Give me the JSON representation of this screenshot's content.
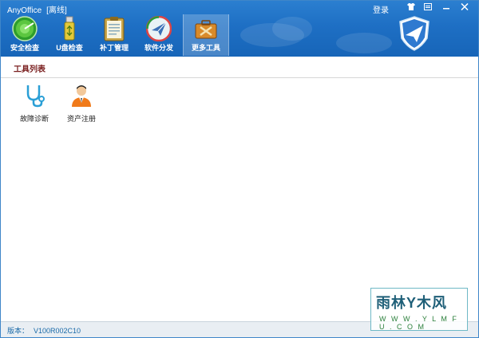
{
  "app": {
    "title": "AnyOffice",
    "status": "[离线]",
    "login": "登录"
  },
  "window_controls": [
    "shirt-icon",
    "menu-icon",
    "minimize-icon",
    "close-icon"
  ],
  "nav": [
    {
      "label": "安全检查",
      "icon": "security-check-icon"
    },
    {
      "label": "U盘检查",
      "icon": "usb-drive-icon"
    },
    {
      "label": "补丁管理",
      "icon": "patch-clipboard-icon"
    },
    {
      "label": "软件分发",
      "icon": "paper-plane-icon"
    },
    {
      "label": "更多工具",
      "icon": "toolbox-icon"
    }
  ],
  "section": {
    "title": "工具列表"
  },
  "tools": [
    {
      "label": "故障诊断",
      "icon": "stethoscope-icon"
    },
    {
      "label": "资产注册",
      "icon": "person-icon"
    }
  ],
  "footer": {
    "version_label": "版本：",
    "version_value": "V100R002C10"
  },
  "watermark": {
    "big": "雨林Y木风",
    "small": "W W W . Y L M F U . C O M"
  },
  "colors": {
    "header": "#1e6fc4",
    "section_title": "#7a1f1f",
    "version": "#1a6aa8"
  }
}
